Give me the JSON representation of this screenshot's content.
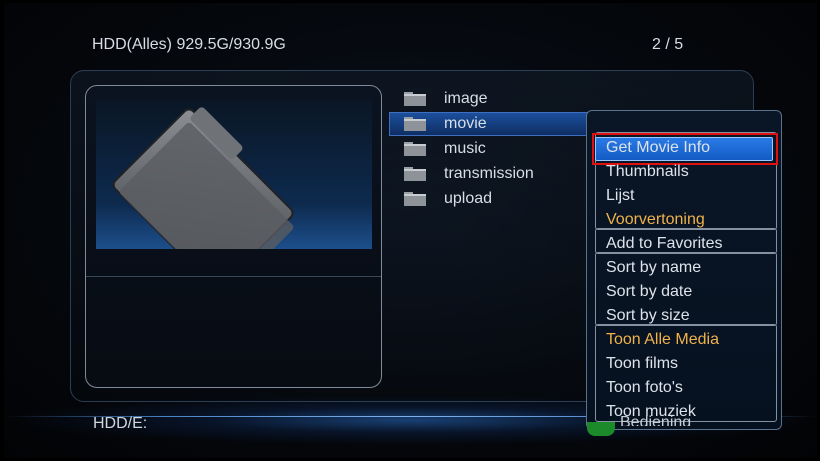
{
  "header": {
    "title": "HDD(Alles) 929.5G/930.9G",
    "page_indicator": "2 / 5"
  },
  "files": [
    {
      "name": "image",
      "selected": false
    },
    {
      "name": "movie",
      "selected": true
    },
    {
      "name": "music",
      "selected": false
    },
    {
      "name": "transmission",
      "selected": false
    },
    {
      "name": "upload",
      "selected": false
    }
  ],
  "context_menu": {
    "items": [
      {
        "label": "Get Movie Info",
        "selected": true
      },
      {
        "label": "Thumbnails"
      },
      {
        "label": "Lijst"
      },
      {
        "label": "Voorvertoning",
        "accent": true
      },
      {
        "label": "Add to Favorites"
      },
      {
        "label": "Sort by name"
      },
      {
        "label": "Sort by date"
      },
      {
        "label": "Sort by size"
      },
      {
        "label": "Toon Alle Media",
        "accent": true
      },
      {
        "label": "Toon films"
      },
      {
        "label": "Toon foto's"
      },
      {
        "label": "Toon muziek"
      }
    ]
  },
  "footer": {
    "drive_label": "HDD/E:",
    "hint_label": "Bediening"
  },
  "colors": {
    "accent": "#f0b24a",
    "selection": "#2a7ae6",
    "highlight_outline": "#e01010",
    "hint_button": "#1c8a2a"
  }
}
